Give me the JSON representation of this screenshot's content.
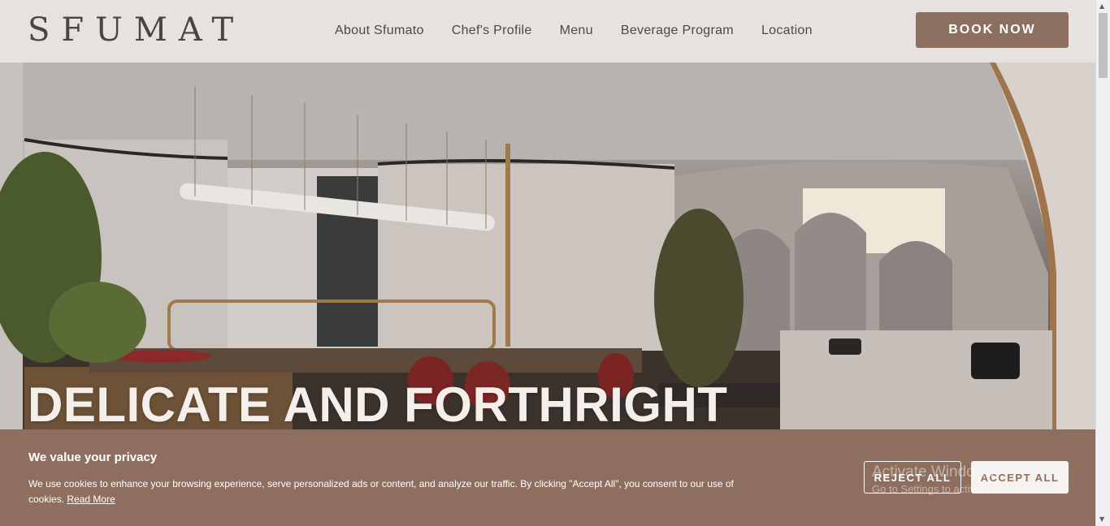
{
  "header": {
    "logo": "SFUMATO",
    "nav": [
      "About Sfumato",
      "Chef's Profile",
      "Menu",
      "Beverage Program",
      "Location"
    ],
    "book_label": "BOOK NOW"
  },
  "hero": {
    "title": "DELICATE AND FORTHRIGHT"
  },
  "cookie": {
    "title": "We value your privacy",
    "text": "We use cookies to enhance your browsing experience, serve personalized ads or content, and analyze our traffic. By clicking \"Accept All\", you consent to our use of cookies.",
    "read_more": "Read More",
    "reject_label": "REJECT ALL",
    "accept_label": "ACCEPT ALL"
  },
  "watermark": {
    "title": "Activate Windows",
    "subtitle": "Go to Settings to activate Windows."
  },
  "colors": {
    "brand": "#8c6f5f",
    "header_bg": "#e5e2e0",
    "text_dark": "#4d4847"
  }
}
